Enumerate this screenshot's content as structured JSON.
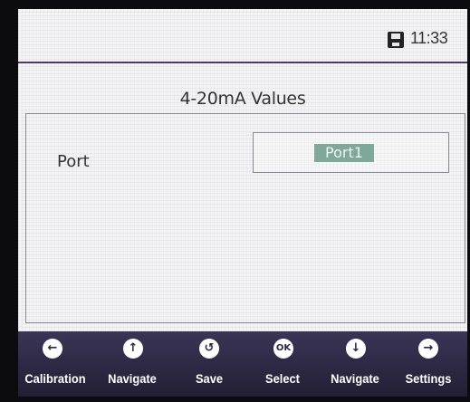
{
  "status": {
    "time": "11:33"
  },
  "title": "4-20mA Values",
  "field": {
    "label": "Port",
    "value": "Port1"
  },
  "softkeys": [
    {
      "label": "Calibration",
      "icon": "arrow-left-icon",
      "glyph": "←"
    },
    {
      "label": "Navigate",
      "icon": "arrow-up-icon",
      "glyph": "↑"
    },
    {
      "label": "Save",
      "icon": "rotate-icon",
      "glyph": "↺"
    },
    {
      "label": "Select",
      "icon": "ok-icon",
      "glyph": "OK"
    },
    {
      "label": "Navigate",
      "icon": "arrow-down-icon",
      "glyph": "↓"
    },
    {
      "label": "Settings",
      "icon": "arrow-right-icon",
      "glyph": "→"
    }
  ],
  "colors": {
    "accent": "#4b3a68",
    "selection": "#7fa89a",
    "softkey_bar": "#2a2740"
  }
}
